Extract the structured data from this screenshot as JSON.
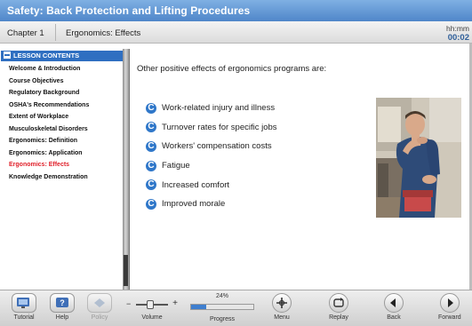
{
  "title": "Safety: Back Protection and Lifting Procedures",
  "chapter": {
    "label": "Chapter 1",
    "topic": "Ergonomics: Effects",
    "time_format": "hh:mm",
    "time_value": "00:02"
  },
  "sidebar": {
    "header": "LESSON CONTENTS",
    "items": [
      "Welcome & Introduction",
      "Course Objectives",
      "Regulatory Background",
      "OSHA's Recommendations",
      "Extent of Workplace",
      "Musculoskeletal Disorders",
      "Ergonomics: Definition",
      "Ergonomics: Application",
      "Ergonomics: Effects",
      "Knowledge Demonstration"
    ],
    "active_index": 8
  },
  "content": {
    "intro": "Other positive effects of ergonomics programs are:",
    "bullet_icon": "C",
    "bullets": [
      "Work-related injury and illness",
      "Turnover rates for specific jobs",
      "Workers' compensation costs",
      "Fatigue",
      "Increased comfort",
      "Improved morale"
    ]
  },
  "toolbar": {
    "tutorial": "Tutorial",
    "help": "Help",
    "policy": "Policy",
    "volume": "Volume",
    "progress_label": "Progress",
    "progress_percent": "24%",
    "progress_value": 0.24,
    "menu": "Menu",
    "replay": "Replay",
    "back": "Back",
    "forward": "Forward"
  },
  "colors": {
    "title_bar": "#4f86c9",
    "accent_blue": "#2f77c9",
    "active_item": "#e0202a",
    "time_value": "#2f5f9a"
  }
}
